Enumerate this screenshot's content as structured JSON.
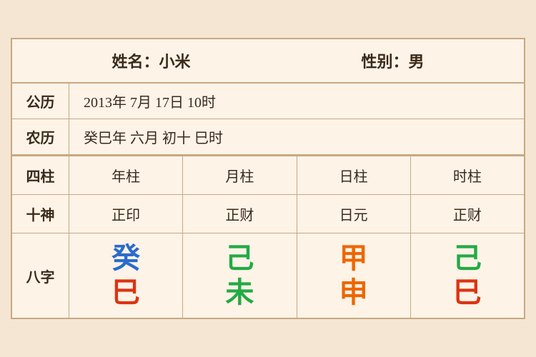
{
  "header": {
    "name_label": "姓名：小米",
    "gender_label": "性别：男"
  },
  "gregorian": {
    "label": "公历",
    "value": "2013年 7月 17日 10时"
  },
  "lunar": {
    "label": "农历",
    "value": "癸巳年 六月 初十 巳时"
  },
  "grid": {
    "header_label": "四柱",
    "headers": [
      "年柱",
      "月柱",
      "日柱",
      "时柱"
    ],
    "shishen_label": "十神",
    "shishen": [
      "正印",
      "正财",
      "日元",
      "正财"
    ],
    "bazi_label": "八字",
    "bazi": [
      {
        "top": "癸",
        "top_color": "blue",
        "bottom": "巳",
        "bottom_color": "red"
      },
      {
        "top": "己",
        "top_color": "green",
        "bottom": "未",
        "bottom_color": "green"
      },
      {
        "top": "甲",
        "top_color": "orange",
        "bottom": "申",
        "bottom_color": "orange"
      },
      {
        "top": "己",
        "top_color": "green",
        "bottom": "巳",
        "bottom_color": "red"
      }
    ]
  }
}
